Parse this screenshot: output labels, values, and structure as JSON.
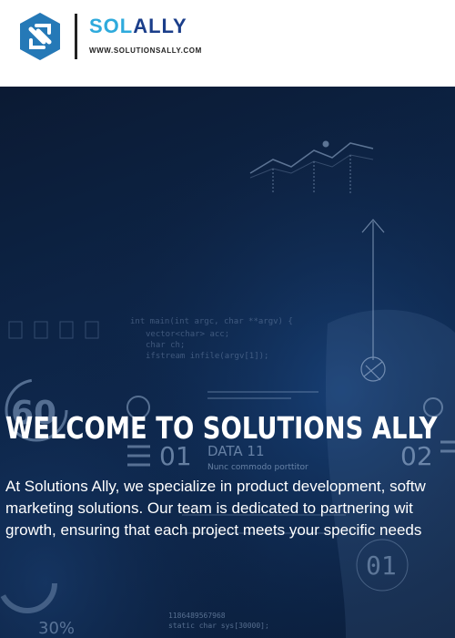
{
  "header": {
    "brand_sol": "SOL",
    "brand_ally": "ALLY",
    "url": "WWW.SOLUTIONSALLY.COM"
  },
  "hero": {
    "title": "WELCOME TO SOLUTIONS ALLY",
    "lines": [
      "At Solutions Ally, we specialize in product development, softw",
      "marketing solutions. Our team is dedicated to partnering wit",
      "growth, ensuring that each project meets your specific needs"
    ],
    "bg_code": [
      "int main(int argc, char **argv) {",
      "vector<char> acc;",
      "char ch;",
      "ifstream infile(argv[1]);"
    ],
    "bg_labels": {
      "data": "DATA 11",
      "left_num": "01",
      "right_num": "02",
      "big_num": "60",
      "nunc": "Nunc commodo porttitor",
      "lower_num": "01",
      "percent": "30%",
      "bottom_code_1": "1186489567968",
      "bottom_code_2": "static char sys[30000];"
    }
  },
  "colors": {
    "brand_light": "#2eaadc",
    "brand_dark": "#1b3e8a",
    "hero_bg": "#0d2446"
  }
}
